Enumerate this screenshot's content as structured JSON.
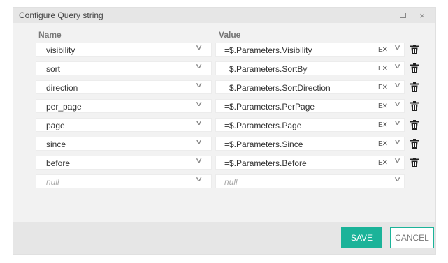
{
  "dialog": {
    "title": "Configure Query string",
    "maximize_icon": "maximize-icon",
    "close_icon": "close-icon",
    "close_glyph": "×"
  },
  "columns": {
    "name": "Name",
    "value": "Value"
  },
  "rows": [
    {
      "name": "visibility",
      "value": "=$.Parameters.Visibility",
      "mode": "EX"
    },
    {
      "name": "sort",
      "value": "=$.Parameters.SortBy",
      "mode": "EX"
    },
    {
      "name": "direction",
      "value": "=$.Parameters.SortDirection",
      "mode": "EX"
    },
    {
      "name": "per_page",
      "value": "=$.Parameters.PerPage",
      "mode": "EX"
    },
    {
      "name": "page",
      "value": "=$.Parameters.Page",
      "mode": "EX"
    },
    {
      "name": "since",
      "value": "=$.Parameters.Since",
      "mode": "EX"
    },
    {
      "name": "before",
      "value": "=$.Parameters.Before",
      "mode": "EX"
    }
  ],
  "new_row": {
    "name_placeholder": "null",
    "value_placeholder": "null"
  },
  "footer": {
    "save_label": "SAVE",
    "cancel_label": "CANCEL"
  },
  "colors": {
    "accent": "#1bb399",
    "dialog_bg": "#f2f2f2",
    "titlebar_bg": "#e6e6e6"
  }
}
